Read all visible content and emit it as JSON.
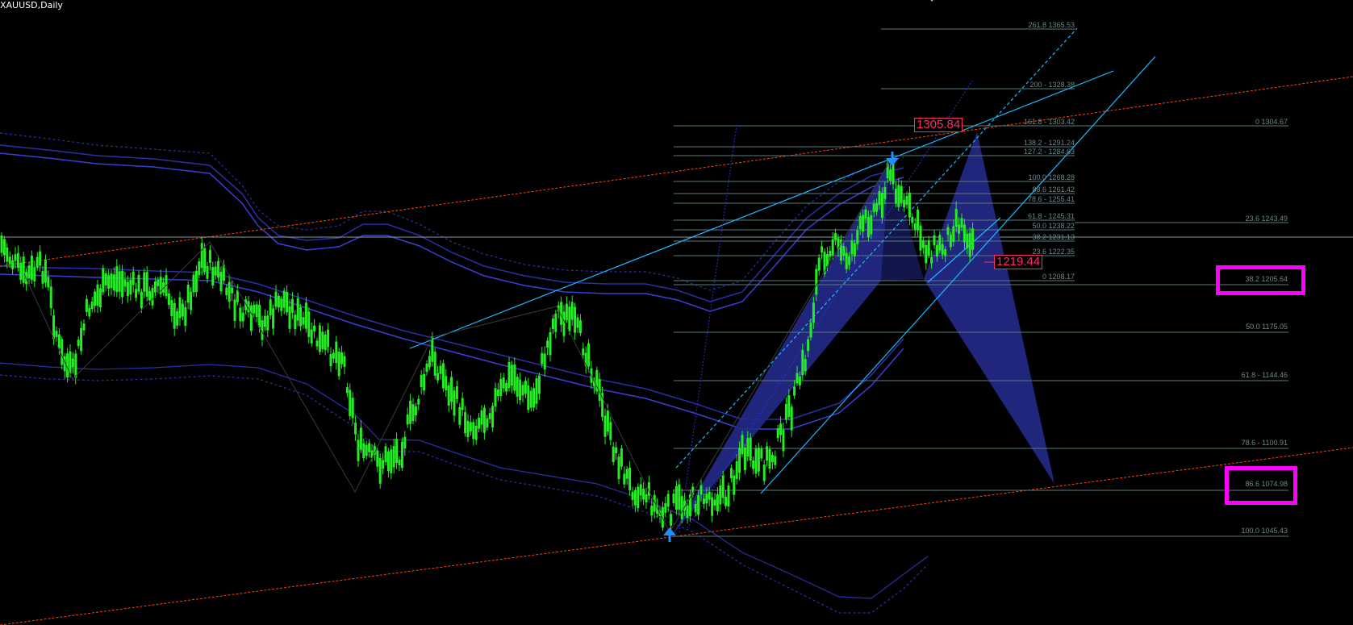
{
  "symbol": "XAUUSD,Daily",
  "price_tags": {
    "high": "1305.84",
    "current": "1219.44"
  },
  "fib_extension": [
    {
      "text": "261.8 1365.53"
    },
    {
      "text": "200 - 1328.38"
    },
    {
      "text": "161.8 - 1303.42"
    },
    {
      "text": "138.2 - 1291.24"
    },
    {
      "text": "127.2 - 1284.63"
    },
    {
      "text": "100.0 1268.28"
    },
    {
      "text": "88.6 1261.42"
    },
    {
      "text": "78.6 - 1255.41"
    },
    {
      "text": "61.8 - 1245.31"
    },
    {
      "text": "50.0 1238.22"
    },
    {
      "text": "38.2 1231.13"
    },
    {
      "text": "23.6 1222.35"
    },
    {
      "text": "0 1208.17"
    }
  ],
  "fib_retracement": [
    {
      "text": "0 1304.67"
    },
    {
      "text": "23.6 1243.49"
    },
    {
      "text": "38.2 1205.64"
    },
    {
      "text": "50.0 1175.05"
    },
    {
      "text": "61.8 - 1144.46"
    },
    {
      "text": "78.6 - 1100.91"
    },
    {
      "text": "86.6 1074.98"
    },
    {
      "text": "100.0 1045.43"
    }
  ],
  "colors": {
    "background": "#000000",
    "candle": "#22ee22",
    "pattern_fill": "#232a8a",
    "trendline": "#1ab8ff",
    "channel": "#ff4500",
    "fib_line": "#6b8a8a",
    "highlight": "#ff00ff",
    "arrow": "#1e90ff"
  },
  "icons": [
    "arrow-up-icon",
    "arrow-down-icon"
  ]
}
